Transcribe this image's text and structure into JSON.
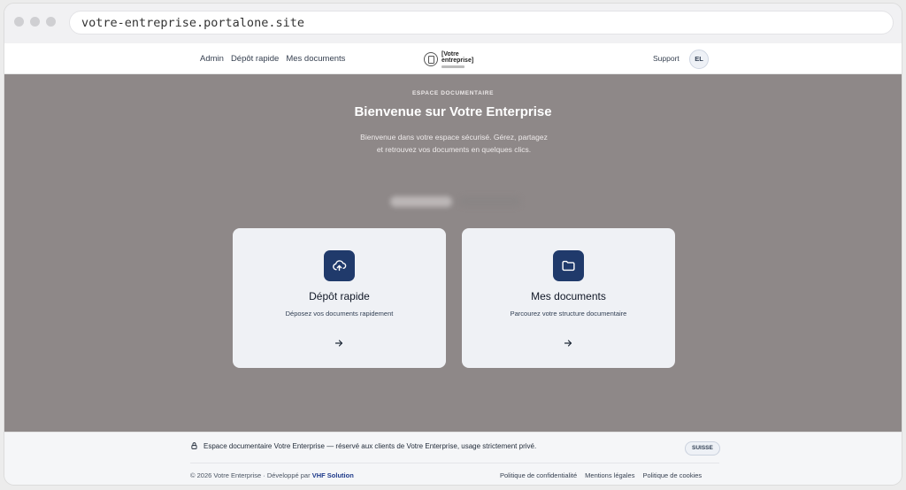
{
  "browser": {
    "url": "votre-entreprise.portalone.site"
  },
  "nav": {
    "links": [
      "Admin",
      "Dépôt rapide",
      "Mes documents"
    ],
    "logo_text": [
      "[Votre",
      "entreprise]"
    ],
    "support": "Support",
    "avatar_initials": "EL"
  },
  "hero": {
    "eyebrow": "ESPACE DOCUMENTAIRE",
    "title": "Bienvenue sur Votre Enterprise",
    "subtitle_line1": "Bienvenue dans votre espace sécurisé. Gérez, partagez",
    "subtitle_line2": "et retrouvez vos documents en quelques clics."
  },
  "cards": [
    {
      "title": "Dépôt rapide",
      "description": "Déposez vos documents rapidement",
      "icon": "cloud-upload-icon"
    },
    {
      "title": "Mes documents",
      "description": "Parcourez votre structure documentaire",
      "icon": "folder-icon"
    }
  ],
  "footer": {
    "notice": "Espace documentaire Votre Enterprise — réservé aux clients de Votre Enterprise, usage strictement privé.",
    "badge": "SUISSE",
    "copyright_prefix": "© 2026 Votre Enterprise · Développé par ",
    "developer": "VHF Solution",
    "legal_links": [
      "Politique de confidentialité",
      "Mentions légales",
      "Politique de cookies"
    ]
  },
  "colors": {
    "hero_bg": "#8e8888",
    "accent": "#203a6b",
    "card_bg": "#eff1f5"
  }
}
